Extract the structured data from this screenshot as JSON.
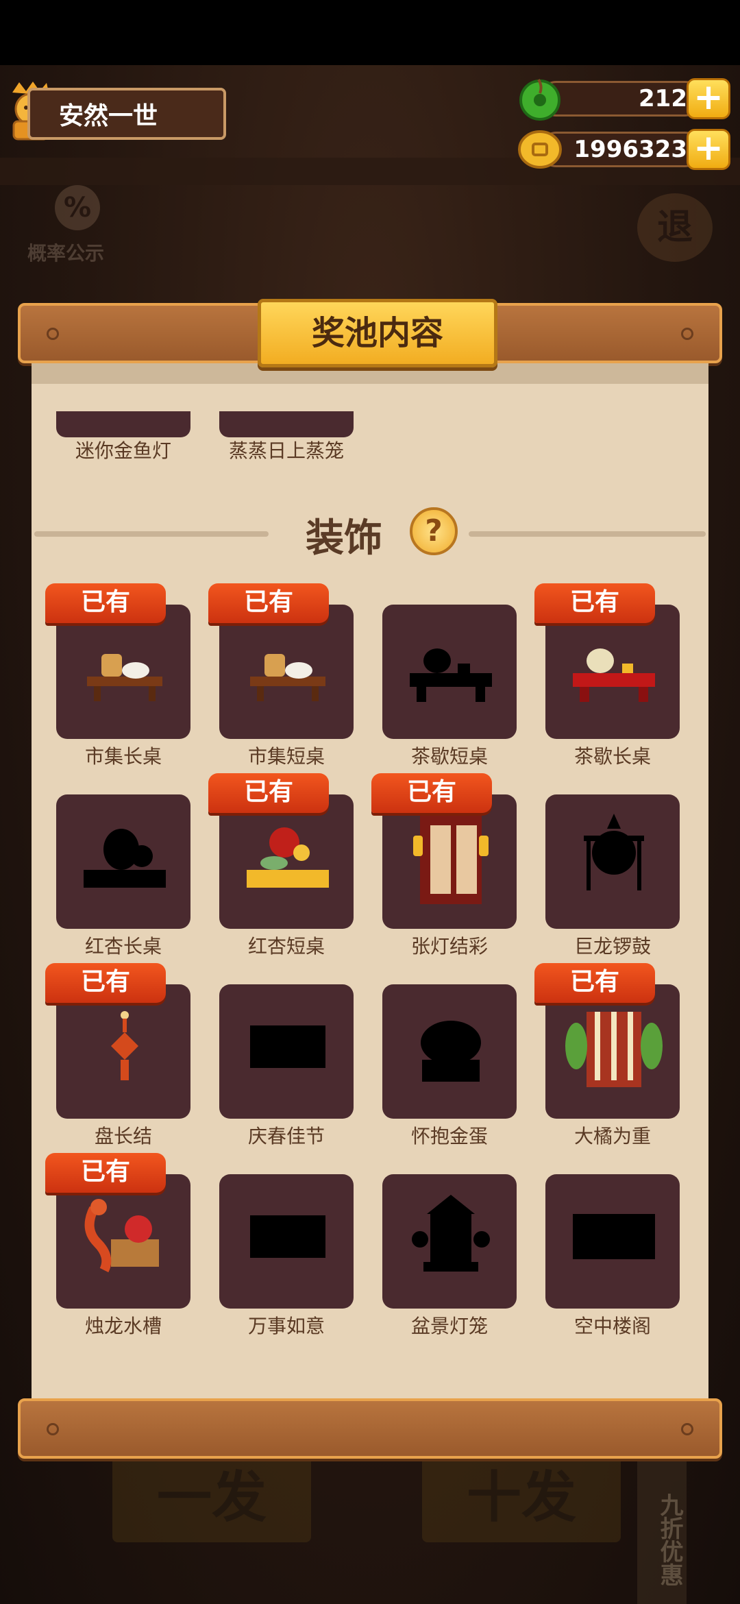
{
  "player": {
    "name": "安然一世"
  },
  "currencies": [
    {
      "name": "jade",
      "value": "212",
      "color": "#3fae2c"
    },
    {
      "name": "coin",
      "value": "1996323",
      "color": "#f2b92a"
    }
  ],
  "top_buttons": {
    "probability": "概率公示",
    "exit": "退"
  },
  "panel": {
    "title": "奖池内容"
  },
  "previous_section_items": [
    "迷你金鱼灯",
    "蒸蒸日上蒸笼"
  ],
  "section": {
    "title": "装饰",
    "help": "?"
  },
  "owned_label": "已有",
  "items": [
    {
      "name": "市集长桌",
      "owned": true,
      "icon": "market-long-table-icon"
    },
    {
      "name": "市集短桌",
      "owned": true,
      "icon": "market-short-table-icon"
    },
    {
      "name": "茶歇短桌",
      "owned": false,
      "icon": "tea-short-table-icon"
    },
    {
      "name": "茶歇长桌",
      "owned": true,
      "icon": "tea-long-table-icon"
    },
    {
      "name": "红杏长桌",
      "owned": false,
      "icon": "apricot-long-table-icon"
    },
    {
      "name": "红杏短桌",
      "owned": true,
      "icon": "apricot-short-table-icon"
    },
    {
      "name": "张灯结彩",
      "owned": true,
      "icon": "lantern-decoration-icon"
    },
    {
      "name": "巨龙锣鼓",
      "owned": false,
      "icon": "dragon-gong-icon"
    },
    {
      "name": "盘长结",
      "owned": true,
      "icon": "chinese-knot-icon"
    },
    {
      "name": "庆春佳节",
      "owned": false,
      "icon": "spring-festival-icon"
    },
    {
      "name": "怀抱金蛋",
      "owned": false,
      "icon": "golden-egg-icon"
    },
    {
      "name": "大橘为重",
      "owned": true,
      "icon": "orange-tree-icon"
    },
    {
      "name": "烛龙水槽",
      "owned": true,
      "icon": "dragon-trough-icon"
    },
    {
      "name": "万事如意",
      "owned": false,
      "icon": "wanshi-ruyi-icon"
    },
    {
      "name": "盆景灯笼",
      "owned": false,
      "icon": "bonsai-lantern-icon"
    },
    {
      "name": "空中楼阁",
      "owned": false,
      "icon": "castle-in-air-icon"
    }
  ],
  "bottom_buttons": {
    "single": "一发",
    "ten": "十发",
    "discount": "九折优惠"
  }
}
